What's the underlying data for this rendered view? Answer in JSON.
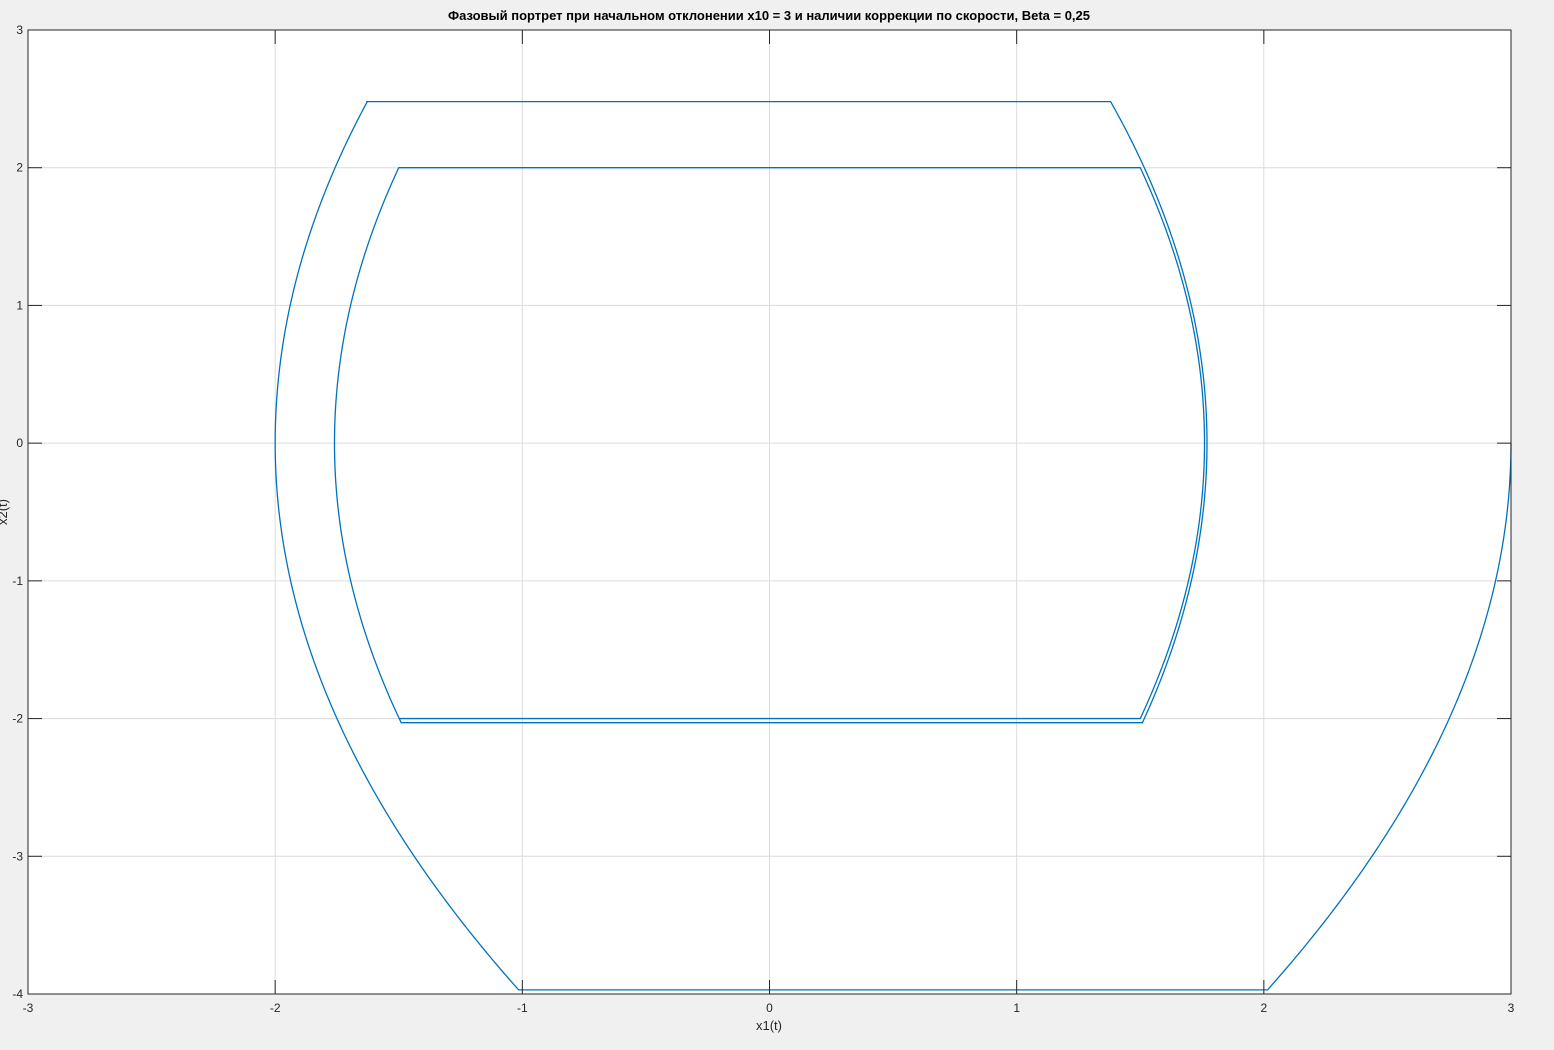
{
  "chart_data": {
    "type": "line",
    "title": "Фазовый портрет при начальном отклонении x10 = 3 и наличии коррекции по скорости, Beta = 0,25",
    "xlabel": "x1(t)",
    "ylabel": "x2(t)",
    "xlim": [
      -3,
      3
    ],
    "ylim": [
      -4,
      3
    ],
    "xticks": [
      "-3",
      "-2",
      "-1",
      "0",
      "1",
      "2",
      "3"
    ],
    "yticks": [
      "-4",
      "-3",
      "-2",
      "-1",
      "0",
      "1",
      "2",
      "3"
    ],
    "grid": true,
    "colors": {
      "line": "#0072bd",
      "grid": "#dcdcdc",
      "axes": "#262626",
      "plot_bg": "#ffffff",
      "figure_bg": "#f0f0f0"
    },
    "series": [
      {
        "segments": [
          {
            "kind": "arc",
            "from_y": 0,
            "to_y": -3.97,
            "c": 3,
            "k": 0.0625,
            "side": 1
          },
          {
            "kind": "line",
            "points": [
              [
                2.0,
                -3.97
              ],
              [
                -1.0,
                -3.97
              ]
            ]
          },
          {
            "kind": "arc",
            "from_y": -3.97,
            "to_y": 0,
            "c": -2.0,
            "k": 0.0625,
            "side": -1
          },
          {
            "kind": "arc",
            "from_y": 0,
            "to_y": 2.48,
            "c": -2.0,
            "k": 0.0606,
            "side": -1
          },
          {
            "kind": "line",
            "points": [
              [
                -1.63,
                2.48
              ],
              [
                1.38,
                2.48
              ]
            ]
          },
          {
            "kind": "arc",
            "from_y": 2.48,
            "to_y": 0,
            "c": 1.77,
            "k": 0.0634,
            "side": 1
          },
          {
            "kind": "arc",
            "from_y": 0,
            "to_y": -2.03,
            "c": 1.77,
            "k": 0.0634,
            "side": 1
          },
          {
            "kind": "line",
            "points": [
              [
                1.51,
                -2.03
              ],
              [
                -1.49,
                -2.03
              ]
            ]
          },
          {
            "kind": "arc",
            "from_y": -2.03,
            "to_y": 0,
            "c": -1.76,
            "k": 0.0655,
            "side": -1
          },
          {
            "kind": "arc",
            "from_y": 0,
            "to_y": 2.0,
            "c": -1.76,
            "k": 0.065,
            "side": -1
          },
          {
            "kind": "line",
            "points": [
              [
                -1.5,
                2.0
              ],
              [
                1.5,
                2.0
              ]
            ]
          },
          {
            "kind": "arc",
            "from_y": 2.0,
            "to_y": 0,
            "c": 1.76,
            "k": 0.065,
            "side": 1
          },
          {
            "kind": "arc",
            "from_y": 0,
            "to_y": -2.0,
            "c": 1.76,
            "k": 0.065,
            "side": 1
          },
          {
            "kind": "line",
            "points": [
              [
                1.5,
                -2.0
              ],
              [
                -1.5,
                -2.0
              ]
            ]
          }
        ]
      }
    ]
  }
}
